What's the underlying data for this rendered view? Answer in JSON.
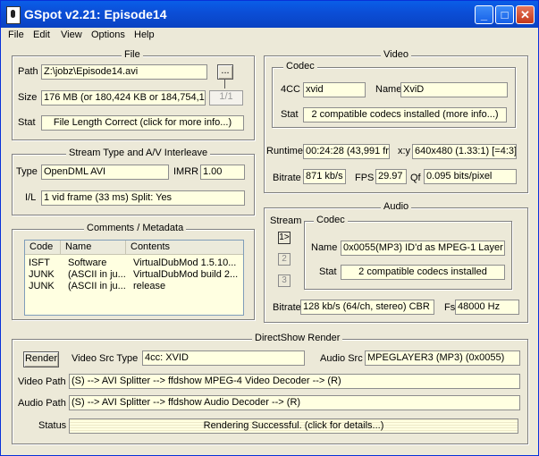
{
  "window": {
    "title": "GSpot v2.21: Episode14"
  },
  "menu": [
    "File",
    "Edit",
    "View",
    "Options",
    "Help"
  ],
  "file": {
    "title": "File",
    "path_label": "Path",
    "path_value": "Z:\\jobz\\Episode14.avi",
    "browse_label": "...",
    "size_label": "Size",
    "size_value": "176 MB (or 180,424 KB or 184,754,1",
    "size_counter": "1/1",
    "stat_label": "Stat",
    "stat_value": "File Length Correct (click for more info...)"
  },
  "stream": {
    "title": "Stream Type and A/V Interleave",
    "type_label": "Type",
    "type_value": "OpenDML AVI",
    "imrr_label": "IMRR",
    "imrr_value": "1.00",
    "il_label": "I/L",
    "il_value": "1 vid frame (33 ms)  Split: Yes"
  },
  "comments": {
    "title": "Comments / Metadata",
    "columns": [
      "Code",
      "Name",
      "Contents"
    ],
    "rows": [
      {
        "code": "ISFT",
        "name": "Software",
        "contents": "VirtualDubMod 1.5.10..."
      },
      {
        "code": "JUNK",
        "name": "(ASCII in ju...",
        "contents": "VirtualDubMod build 2..."
      },
      {
        "code": "JUNK",
        "name": "(ASCII in ju...",
        "contents": "release"
      }
    ]
  },
  "video": {
    "title": "Video",
    "codec_title": "Codec",
    "fourcc_label": "4CC",
    "fourcc_value": "xvid",
    "name_label": "Name",
    "name_value": "XviD",
    "stat_label": "Stat",
    "stat_value": "2 compatible codecs installed (more info...)",
    "runtime_label": "Runtime",
    "runtime_value": "00:24:28 (43,991 fr)",
    "xy_label": "x:y",
    "xy_value": "640x480 (1.33:1) [=4:3]",
    "bitrate_label": "Bitrate",
    "bitrate_value": "871 kb/s",
    "fps_label": "FPS",
    "fps_value": "29.97",
    "qf_label": "Qf",
    "qf_value": "0.095 bits/pixel"
  },
  "audio": {
    "title": "Audio",
    "stream_label": "Stream",
    "stream_buttons": [
      "1>",
      "2",
      "3"
    ],
    "codec_title": "Codec",
    "name_label": "Name",
    "name_value": "0x0055(MP3) ID'd as MPEG-1 Layer 3",
    "stat_label": "Stat",
    "stat_value": "2 compatible codecs installed",
    "bitrate_label": "Bitrate",
    "bitrate_value": "128 kb/s (64/ch, stereo) CBR",
    "fs_label": "Fs",
    "fs_value": "48000 Hz"
  },
  "directshow": {
    "title": "DirectShow Render",
    "render_button": "Render",
    "video_src_type_label": "Video Src Type",
    "video_src_type_value": "4cc: XVID",
    "audio_src_label": "Audio Src",
    "audio_src_value": "MPEGLAYER3 (MP3) (0x0055)",
    "video_path_label": "Video Path",
    "video_path_value": "(S) --> AVI Splitter --> ffdshow MPEG-4 Video Decoder --> (R)",
    "audio_path_label": "Audio Path",
    "audio_path_value": "(S) --> AVI Splitter --> ffdshow Audio Decoder --> (R)",
    "status_label": "Status",
    "status_value": "Rendering Successful.  (click for details...)"
  }
}
